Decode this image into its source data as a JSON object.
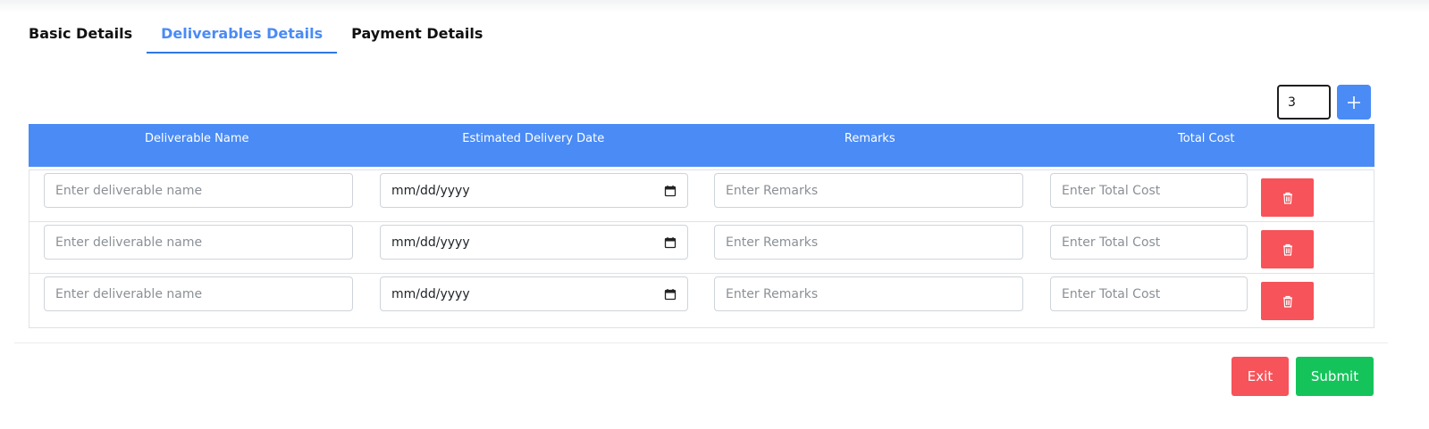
{
  "tabs": [
    {
      "label": "Basic Details",
      "active": false
    },
    {
      "label": "Deliverables Details",
      "active": true
    },
    {
      "label": "Payment Details",
      "active": false
    }
  ],
  "row_count_input": {
    "value": "3"
  },
  "add_button": {
    "icon": "plus-icon"
  },
  "table": {
    "headers": [
      "Deliverable Name",
      "Estimated Delivery Date",
      "Remarks",
      "Total Cost"
    ],
    "rows": [
      {
        "name_placeholder": "Enter deliverable name",
        "date_text": "mm/dd/yyyy",
        "remarks_placeholder": "Enter Remarks",
        "cost_placeholder": "Enter Total Cost"
      },
      {
        "name_placeholder": "Enter deliverable name",
        "date_text": "mm/dd/yyyy",
        "remarks_placeholder": "Enter Remarks",
        "cost_placeholder": "Enter Total Cost"
      },
      {
        "name_placeholder": "Enter deliverable name",
        "date_text": "mm/dd/yyyy",
        "remarks_placeholder": "Enter Remarks",
        "cost_placeholder": "Enter Total Cost"
      }
    ]
  },
  "footer": {
    "exit_label": "Exit",
    "submit_label": "Submit"
  },
  "colors": {
    "accent": "#4a8bf5",
    "danger": "#f6535a",
    "success": "#14c45b"
  }
}
